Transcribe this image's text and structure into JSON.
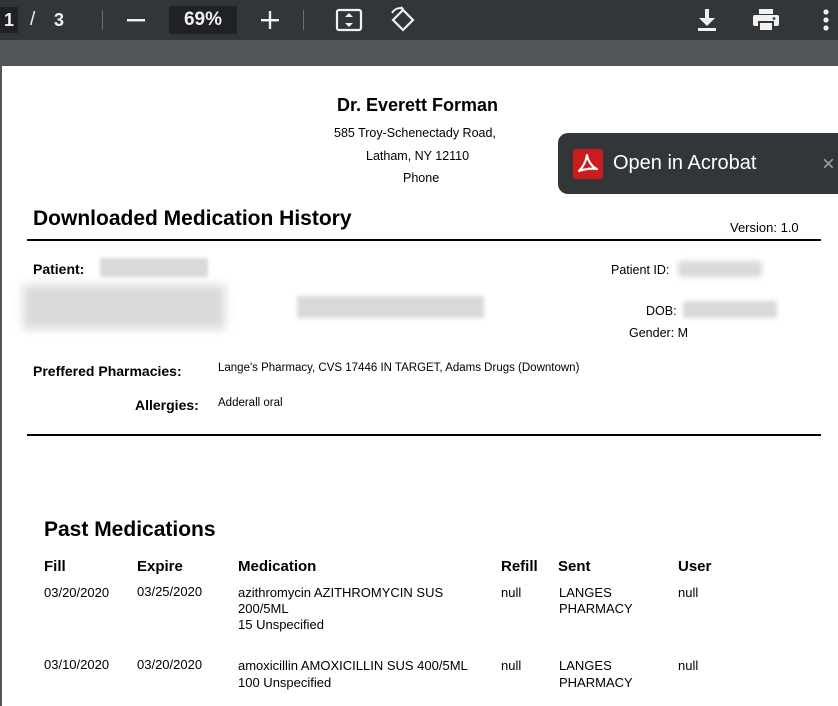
{
  "toolbar": {
    "page_current": "1",
    "page_separator": "/",
    "page_total": "3",
    "zoom": "69%",
    "icons": [
      "zoom-out-icon",
      "zoom-in-icon",
      "fit-page-icon",
      "rotate-icon",
      "download-icon",
      "print-icon",
      "more-icon"
    ]
  },
  "header": {
    "doctor": "Dr. Everett Forman",
    "address1": "585 Troy-Schenectady Road,",
    "address2": "Latham, NY 12110",
    "phone": "Phone"
  },
  "popup": {
    "label": "Open in Acrobat",
    "close": "×"
  },
  "doc": {
    "title": "Downloaded Medication History",
    "version": "Version: 1.0",
    "patient_label": "Patient:",
    "patient_id_label": "Patient ID:",
    "dob_label": "DOB:",
    "gender": "Gender: M",
    "pharmacies_label": "Preffered Pharmacies:",
    "pharmacies": "Lange's Pharmacy, CVS 17446 IN TARGET, Adams Drugs (Downtown)",
    "allergies_label": "Allergies:",
    "allergies": "Adderall oral"
  },
  "past": {
    "title": "Past Medications",
    "headers": [
      "Fill",
      "Expire",
      "Medication",
      "Refill",
      "Sent",
      "User"
    ],
    "rows": [
      {
        "fill": "03/20/2020",
        "expire": "03/25/2020",
        "med_line1": "azithromycin  AZITHROMYCIN SUS",
        "med_line2": "200/5ML",
        "med_line3": "15 Unspecified",
        "refill": "null",
        "sent_line1": "LANGES",
        "sent_line2": "PHARMACY",
        "user": "null"
      },
      {
        "fill": "03/10/2020",
        "expire": "03/20/2020",
        "med_line1": "amoxicillin  AMOXICILLIN  SUS 400/5ML",
        "med_line2": "100 Unspecified",
        "refill": "null",
        "sent_line1": "LANGES",
        "sent_line2": "PHARMACY",
        "user": "null"
      }
    ]
  }
}
